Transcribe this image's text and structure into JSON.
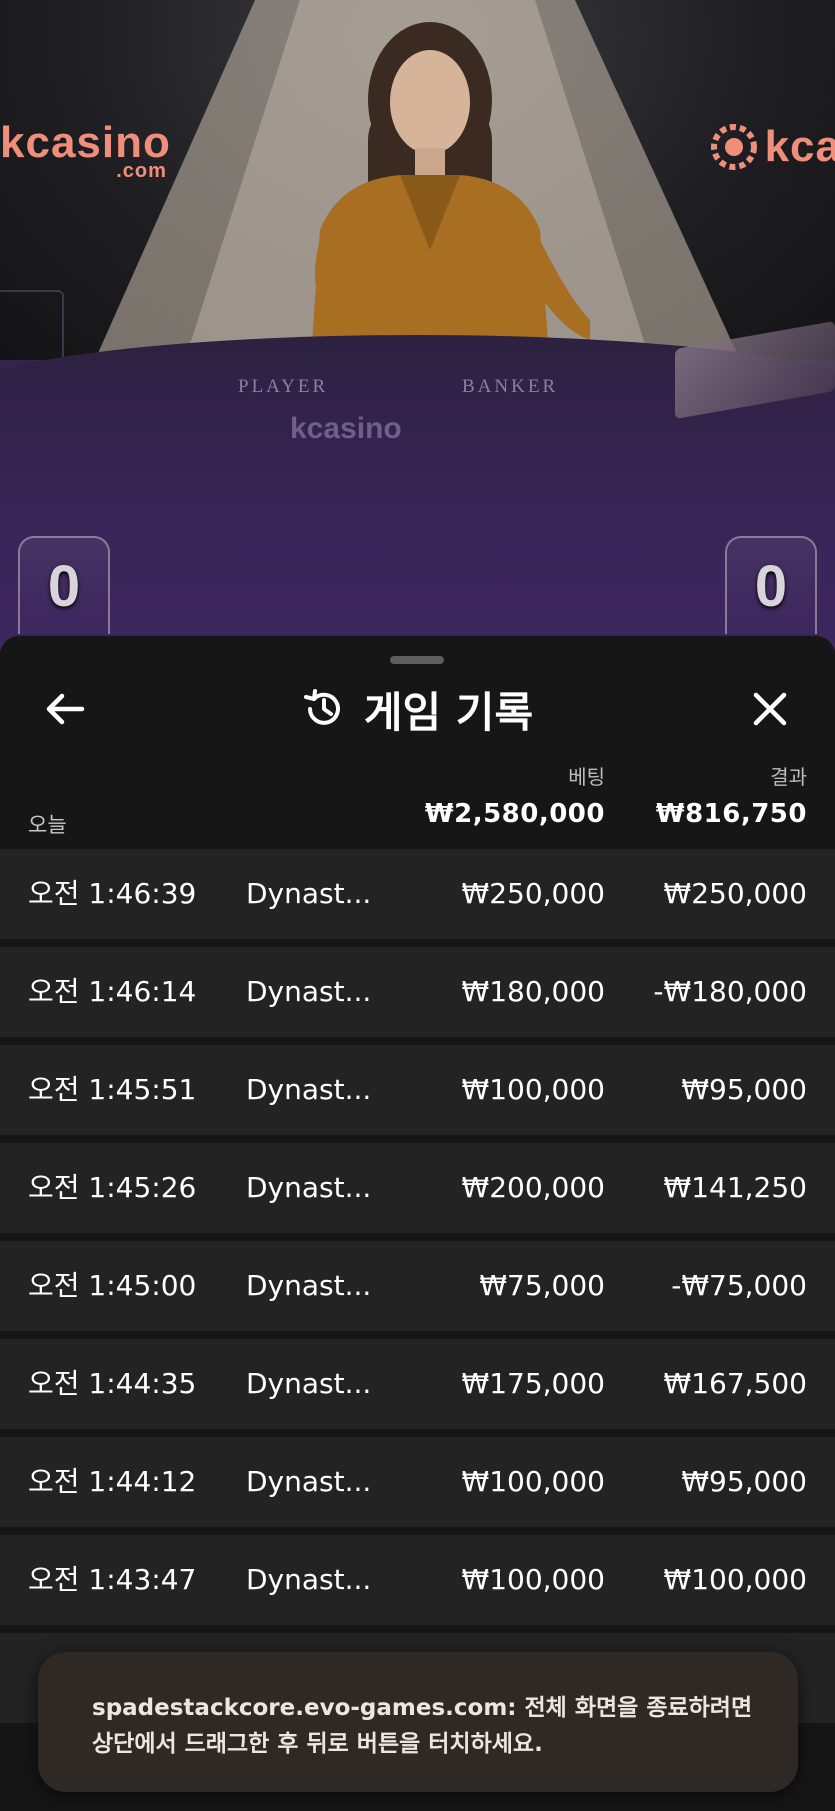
{
  "video": {
    "brand_left": "kcasino",
    "brand_left_sub": ".com",
    "brand_right": "kca",
    "table_player_label": "PLAYER",
    "table_banker_label": "BANKER",
    "table_brand": "kcasino",
    "player_score": "0",
    "banker_score": "0"
  },
  "sheet": {
    "title": "게임 기록",
    "icons": {
      "back": "arrow-left-icon",
      "history": "history-icon",
      "close": "close-icon"
    },
    "columns": {
      "bet": "베팅",
      "result": "결과"
    },
    "summary": {
      "label": "오늘",
      "total_bet": "₩2,580,000",
      "total_result": "₩816,750"
    },
    "rows": [
      {
        "time": "오전 1:46:39",
        "game": "Dynast...",
        "bet": "₩250,000",
        "result": "₩250,000"
      },
      {
        "time": "오전 1:46:14",
        "game": "Dynast...",
        "bet": "₩180,000",
        "result": "-₩180,000"
      },
      {
        "time": "오전 1:45:51",
        "game": "Dynast...",
        "bet": "₩100,000",
        "result": "₩95,000"
      },
      {
        "time": "오전 1:45:26",
        "game": "Dynast...",
        "bet": "₩200,000",
        "result": "₩141,250"
      },
      {
        "time": "오전 1:45:00",
        "game": "Dynast...",
        "bet": "₩75,000",
        "result": "-₩75,000"
      },
      {
        "time": "오전 1:44:35",
        "game": "Dynast...",
        "bet": "₩175,000",
        "result": "₩167,500"
      },
      {
        "time": "오전 1:44:12",
        "game": "Dynast...",
        "bet": "₩100,000",
        "result": "₩95,000"
      },
      {
        "time": "오전 1:43:47",
        "game": "Dynast...",
        "bet": "₩100,000",
        "result": "₩100,000"
      }
    ]
  },
  "toast": {
    "text": "spadestackcore.evo-games.com: 전체 화면을 종료하려면 상단에서 드래그한 후 뒤로 버튼을 터치하세요."
  },
  "colors": {
    "sheet_bg": "#161616",
    "row_bg": "#232323",
    "table_felt": "#3a2558",
    "brand": "#ef8e7a",
    "toast_bg": "#2f2926"
  }
}
